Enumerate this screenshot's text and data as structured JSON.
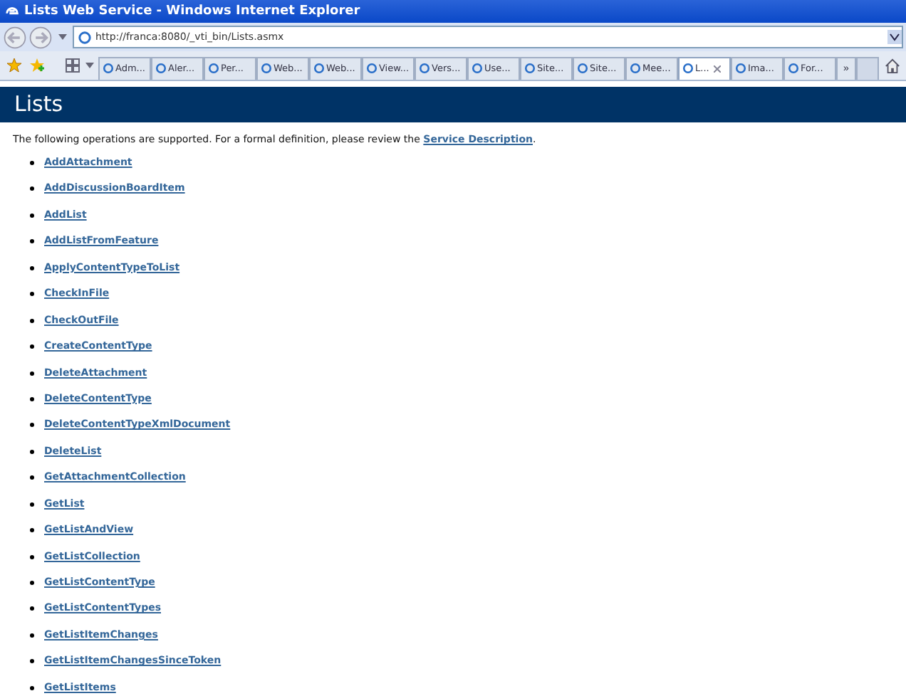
{
  "window": {
    "title": "Lists Web Service - Windows Internet Explorer"
  },
  "address_bar": {
    "value": "http://franca:8080/_vti_bin/Lists.asmx"
  },
  "tabs": [
    {
      "label": "Adm...",
      "selected": false
    },
    {
      "label": "Aler...",
      "selected": false
    },
    {
      "label": "Per...",
      "selected": false
    },
    {
      "label": "Web...",
      "selected": false
    },
    {
      "label": "Web...",
      "selected": false
    },
    {
      "label": "View...",
      "selected": false
    },
    {
      "label": "Vers...",
      "selected": false
    },
    {
      "label": "Use...",
      "selected": false
    },
    {
      "label": "Site...",
      "selected": false
    },
    {
      "label": "Site...",
      "selected": false
    },
    {
      "label": "Mee...",
      "selected": false
    },
    {
      "label": "L...",
      "selected": true
    },
    {
      "label": "Ima...",
      "selected": false
    },
    {
      "label": "For...",
      "selected": false
    }
  ],
  "tabs_overflow": "»",
  "page": {
    "heading": "Lists",
    "intro": "The following operations are supported. For a formal definition, please review the",
    "intro_link": "Service Description",
    "intro_end": ".",
    "operations": [
      "AddAttachment",
      "AddDiscussionBoardItem",
      "AddList",
      "AddListFromFeature",
      "ApplyContentTypeToList",
      "CheckInFile",
      "CheckOutFile",
      "CreateContentType",
      "DeleteAttachment",
      "DeleteContentType",
      "DeleteContentTypeXmlDocument",
      "DeleteList",
      "GetAttachmentCollection",
      "GetList",
      "GetListAndView",
      "GetListCollection",
      "GetListContentType",
      "GetListContentTypes",
      "GetListItemChanges",
      "GetListItemChangesSinceToken",
      "GetListItems"
    ]
  }
}
